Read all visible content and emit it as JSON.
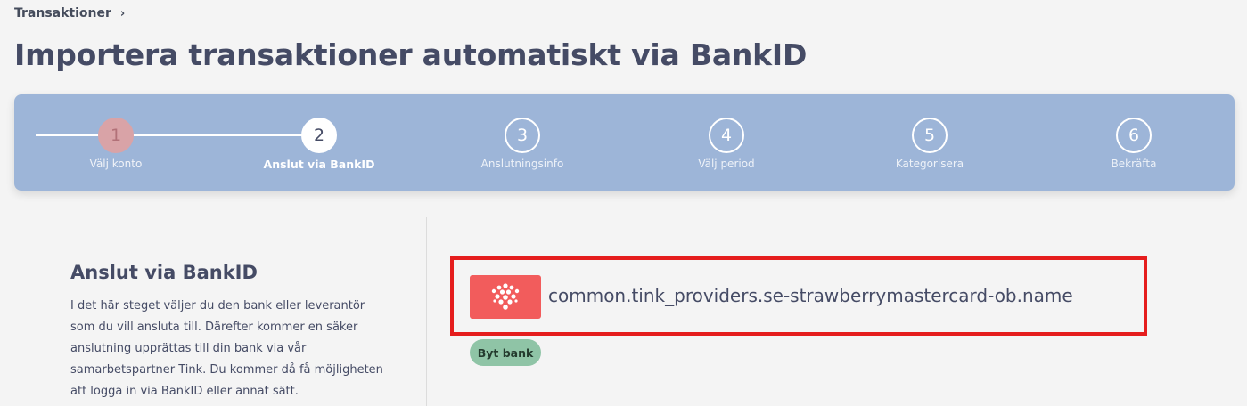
{
  "breadcrumb": {
    "label": "Transaktioner",
    "chevron": "›"
  },
  "page": {
    "title": "Importera transaktioner automatiskt via BankID"
  },
  "stepper": {
    "steps": [
      {
        "number": "1",
        "label": "Välj konto",
        "state": "done"
      },
      {
        "number": "2",
        "label": "Anslut via BankID",
        "state": "active"
      },
      {
        "number": "3",
        "label": "Anslutningsinfo",
        "state": "upcoming"
      },
      {
        "number": "4",
        "label": "Välj period",
        "state": "upcoming"
      },
      {
        "number": "5",
        "label": "Kategorisera",
        "state": "upcoming"
      },
      {
        "number": "6",
        "label": "Bekräfta",
        "state": "upcoming"
      }
    ]
  },
  "info": {
    "title": "Anslut via BankID",
    "text": "I det här steget väljer du den bank eller leverantör som du vill ansluta till. Därefter kommer en säker anslutning upprättas till din bank via vår samarbetspartner Tink. Du kommer då få möjligheten att logga in via BankID eller annat sätt."
  },
  "bank": {
    "logo_icon": "strawberry-logo-icon",
    "name": "common.tink_providers.se-strawberrymastercard-ob.name",
    "change_label": "Byt bank"
  },
  "colors": {
    "stepper_bg": "#9db5d8",
    "done_step": "#d9a3a7",
    "highlight_border": "#e51d1d",
    "bank_logo_bg": "#f25c5c",
    "change_button_bg": "#8fc4a6"
  }
}
